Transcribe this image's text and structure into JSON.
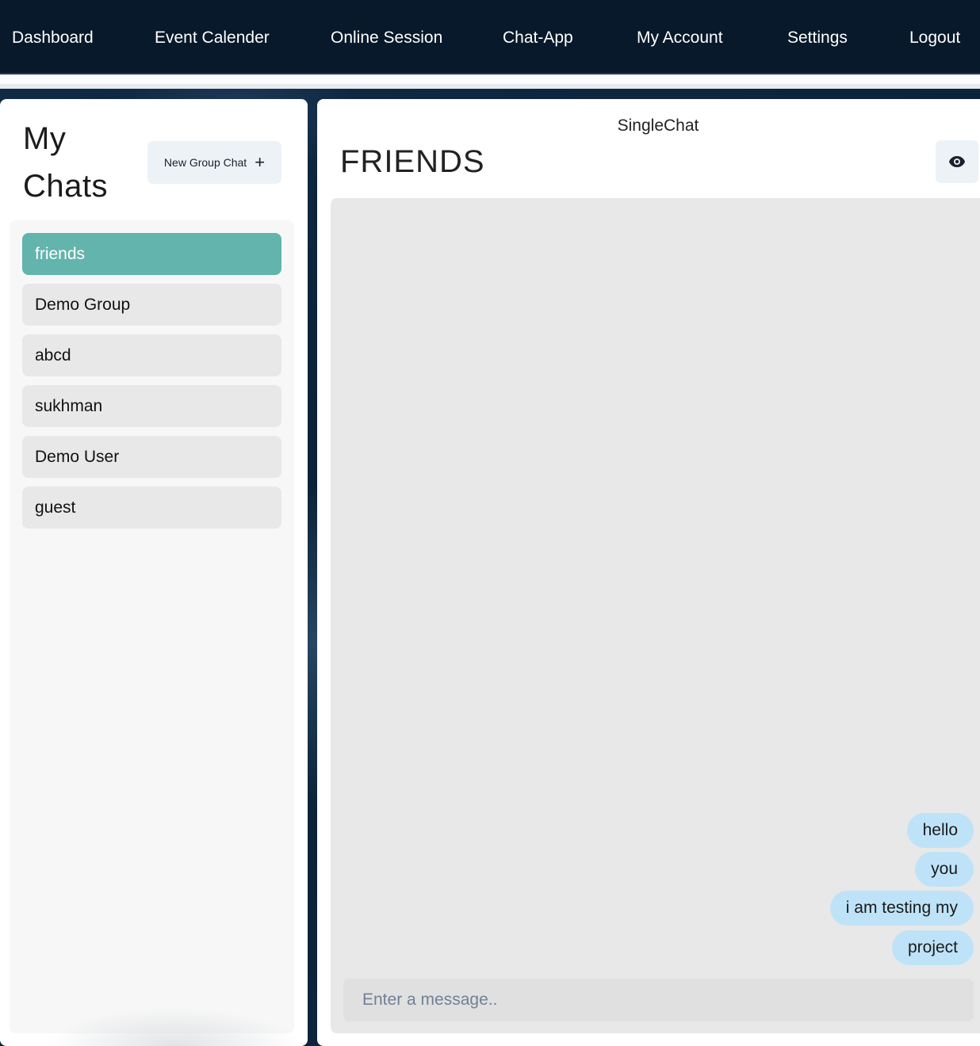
{
  "nav": {
    "items": [
      {
        "label": "Dashboard"
      },
      {
        "label": "Event Calender"
      },
      {
        "label": "Online Session"
      },
      {
        "label": "Chat-App"
      },
      {
        "label": "My Account"
      },
      {
        "label": "Settings"
      },
      {
        "label": "Logout"
      }
    ]
  },
  "sidebar": {
    "title": "My Chats",
    "new_group_label": "New Group Chat",
    "new_group_icon": "plus-icon",
    "chats": [
      {
        "name": "friends",
        "active": true
      },
      {
        "name": "Demo Group",
        "active": false
      },
      {
        "name": "abcd",
        "active": false
      },
      {
        "name": "sukhman",
        "active": false
      },
      {
        "name": "Demo User",
        "active": false
      },
      {
        "name": "guest",
        "active": false
      }
    ]
  },
  "chat": {
    "header_label": "SingleChat",
    "title": "FRIENDS",
    "view_icon": "eye-icon",
    "messages": [
      {
        "text": "hello"
      },
      {
        "text": "you"
      },
      {
        "text": "i am testing my"
      },
      {
        "text": "project"
      }
    ],
    "input_placeholder": "Enter a message..",
    "input_value": ""
  },
  "colors": {
    "navbar_bg": "#07192a",
    "active_chat": "#62b4ac",
    "message_bubble": "#bee3f8",
    "messages_bg": "#e8e8e8"
  }
}
